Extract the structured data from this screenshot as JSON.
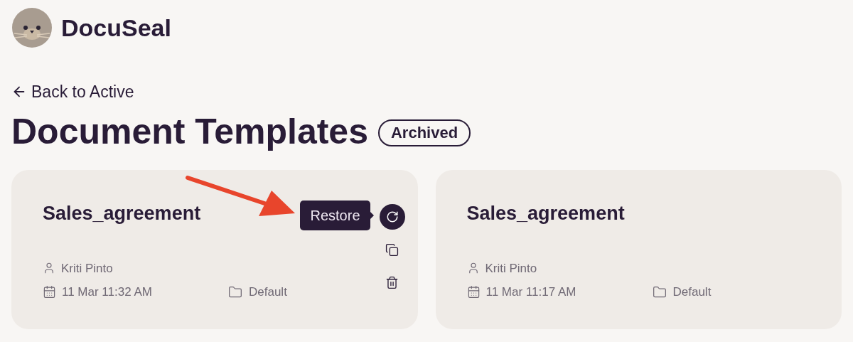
{
  "brand": {
    "name": "DocuSeal"
  },
  "back_link": {
    "label": "Back to Active"
  },
  "heading": {
    "title": "Document Templates",
    "badge": "Archived"
  },
  "cards": [
    {
      "title": "Sales_agreement",
      "author": "Kriti Pinto",
      "date": "11 Mar 11:32 AM",
      "folder": "Default",
      "actions_visible": true,
      "tooltip": "Restore"
    },
    {
      "title": "Sales_agreement",
      "author": "Kriti Pinto",
      "date": "11 Mar 11:17 AM",
      "folder": "Default",
      "actions_visible": false
    }
  ]
}
